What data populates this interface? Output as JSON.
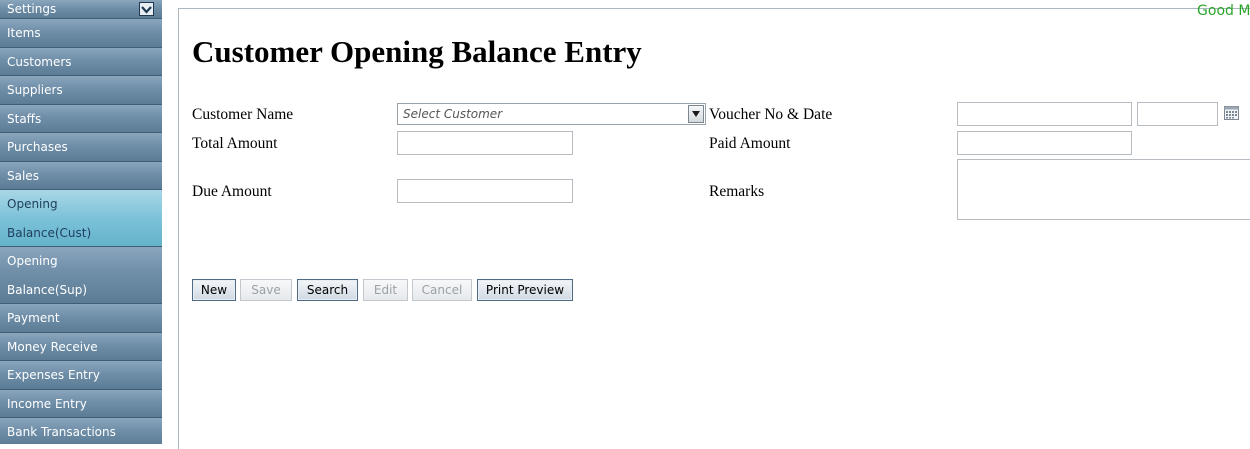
{
  "sidebar": {
    "header": {
      "label": "Settings",
      "toggle_icon": "chevron-down-icon"
    },
    "items": [
      {
        "label": "Items"
      },
      {
        "label": "Customers"
      },
      {
        "label": "Suppliers"
      },
      {
        "label": "Staffs"
      },
      {
        "label": "Purchases"
      },
      {
        "label": "Sales"
      },
      {
        "line1": "Opening",
        "line2": "Balance(Cust)",
        "active": true
      },
      {
        "line1": "Opening",
        "line2": "Balance(Sup)"
      },
      {
        "label": "Payment"
      },
      {
        "label": "Money Receive"
      },
      {
        "label": "Expenses Entry"
      },
      {
        "label": "Income Entry"
      },
      {
        "label": "Bank Transactions"
      }
    ]
  },
  "header": {
    "greeting": "Good Mo"
  },
  "page": {
    "title": "Customer Opening Balance Entry"
  },
  "form": {
    "customer_name_label": "Customer Name",
    "customer_placeholder": "Select Customer",
    "voucher_label": "Voucher No & Date",
    "voucher_no_value": "",
    "voucher_date_value": "",
    "total_amount_label": "Total Amount",
    "total_amount_value": "",
    "paid_amount_label": "Paid Amount",
    "paid_amount_value": "",
    "due_amount_label": "Due Amount",
    "due_amount_value": "",
    "remarks_label": "Remarks",
    "remarks_value": ""
  },
  "buttons": {
    "new": "New",
    "save": "Save",
    "search": "Search",
    "edit": "Edit",
    "cancel": "Cancel",
    "print_preview": "Print Preview"
  },
  "colors": {
    "sidebar_bg": "#6f8ea8",
    "sidebar_active": "#7cc2d8",
    "greeting": "#2aa52a"
  }
}
